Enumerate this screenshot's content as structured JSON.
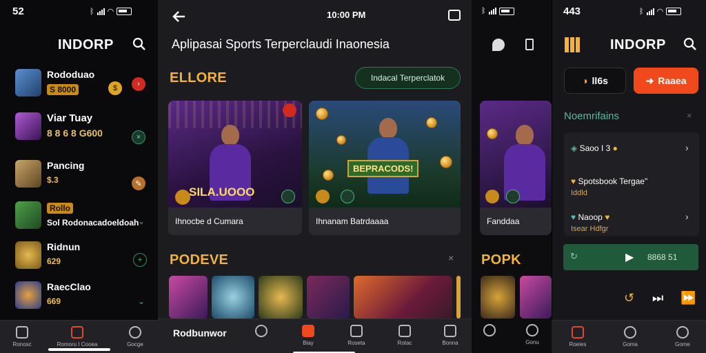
{
  "panel1": {
    "status_time": "52",
    "title": "INDORP",
    "items": [
      {
        "name": "Rododuao",
        "badge": "S 8000"
      },
      {
        "name": "Viar Tuay",
        "badge": "8 8 6 8 G600"
      },
      {
        "name": "Pancing",
        "badge": "$.3"
      },
      {
        "name": "Sol Rodonacadoeldoah",
        "badge": "Rollo"
      },
      {
        "name": "Ridnun",
        "badge": "629"
      },
      {
        "name": "RaecClao",
        "badge": "669"
      }
    ],
    "nav": [
      "Ronosc",
      "Romoru I Cooea",
      "",
      "Gocge"
    ]
  },
  "panel2": {
    "status_time": "10:00 PM",
    "header_title": "Aplipasai Sports Terperclaudi Inaonesia",
    "section_explore": "ELLORE",
    "pill_button": "Indacal Terperclatok",
    "cards": [
      {
        "title": "Ihnocbe d Cumara",
        "overlay": "SILA.UOOO"
      },
      {
        "title": "Ihnanam Batrdaaaa",
        "overlay": "BEPRACODS!"
      }
    ],
    "section_popular": "PODEVE",
    "nav": [
      "Rodbunwor",
      "",
      "Biay",
      "Roseta",
      "Rotac",
      "Bonna"
    ]
  },
  "panel3": {
    "card_title": "Fanddaa",
    "section_popular": "POPK",
    "nav": [
      "",
      "Gonu"
    ]
  },
  "panel4": {
    "status_time": "443",
    "title": "INDORP",
    "btn_left": "ll6s",
    "btn_right": "Raaea",
    "section": "Noemrifains",
    "rows": [
      {
        "label": "Saoo I 3",
        "sub": ""
      },
      {
        "label": "Spotsbook Tergae\"",
        "sub": "Iddld"
      },
      {
        "label": "Naoop",
        "sub": "Isear Hdfgr"
      }
    ],
    "player_text": "8868 51",
    "nav": [
      "Roeies",
      "Goma",
      "Gome"
    ]
  },
  "colors": {
    "accent_gold": "#f2b33d",
    "accent_orange": "#f04a1c",
    "accent_green": "#1f5a3a",
    "panel_bg": "#1c1c20"
  }
}
